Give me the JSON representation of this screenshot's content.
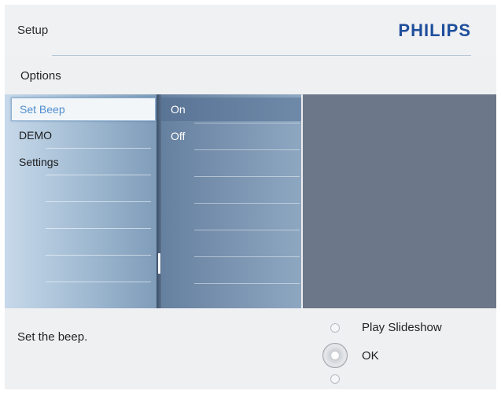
{
  "header": {
    "title": "Setup",
    "brand": "PHILIPS"
  },
  "options": {
    "label": "Options"
  },
  "menu": {
    "column1": [
      {
        "label": "Set Beep",
        "selected": true
      },
      {
        "label": "DEMO",
        "selected": false
      },
      {
        "label": "Settings",
        "selected": false
      }
    ],
    "column2": [
      {
        "label": "On",
        "selected": true
      },
      {
        "label": "Off",
        "selected": false
      }
    ]
  },
  "footer": {
    "status": "Set the beep.",
    "up_action": "Play Slideshow",
    "ok_action": "OK"
  },
  "colors": {
    "brand": "#1f4f9c",
    "menu_light": "#c7d9ea",
    "menu_mid": "#7f9cb9",
    "preview_panel": "#6c7889"
  }
}
